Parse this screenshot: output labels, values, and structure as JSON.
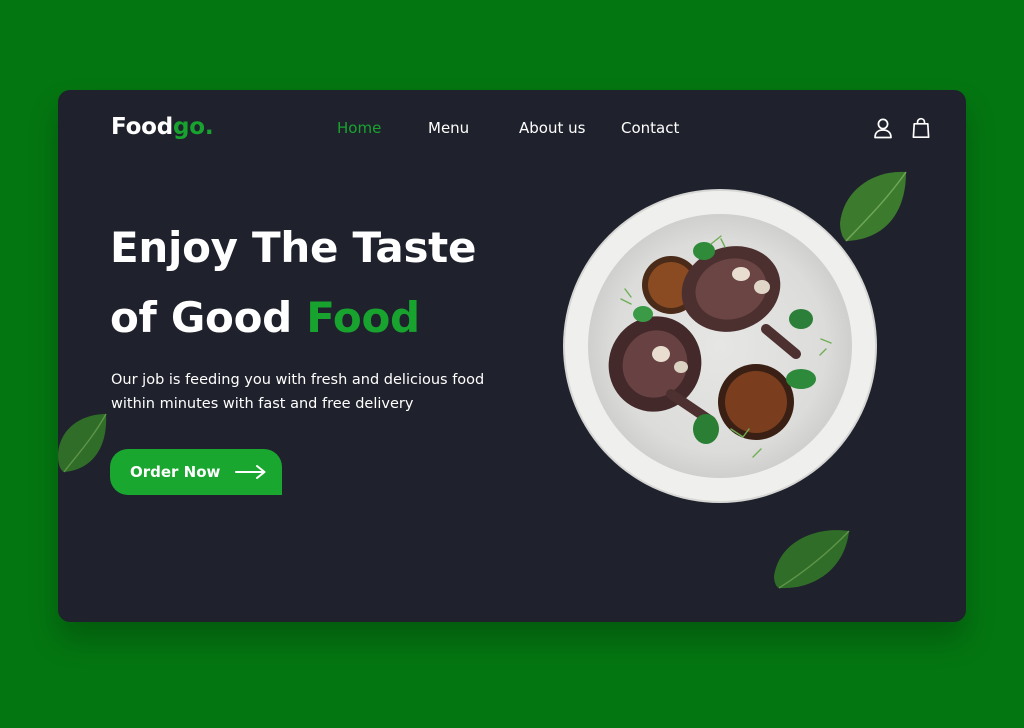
{
  "brand": {
    "name_main": "Food",
    "name_accent": "go."
  },
  "nav": {
    "items": [
      {
        "label": "Home",
        "active": true
      },
      {
        "label": "Menu",
        "active": false
      },
      {
        "label": "About us",
        "active": false
      },
      {
        "label": "Contact",
        "active": false
      }
    ]
  },
  "header_icons": [
    "user-icon",
    "shopping-bag-icon"
  ],
  "hero": {
    "title_line1": "Enjoy The Taste",
    "title_line2_main": "of Good",
    "title_line2_accent": "Food",
    "description": "Our job is feeding you with fresh and delicious food within minutes with fast and free delivery",
    "cta_label": "Order Now",
    "cta_icon": "arrow-right-icon"
  },
  "images": [
    "food-plate-image",
    "basil-leaf-image"
  ],
  "colors": {
    "page_background": "#047611",
    "card_background": "#1f222c",
    "accent": "#18a32f",
    "text": "#ffffff"
  }
}
